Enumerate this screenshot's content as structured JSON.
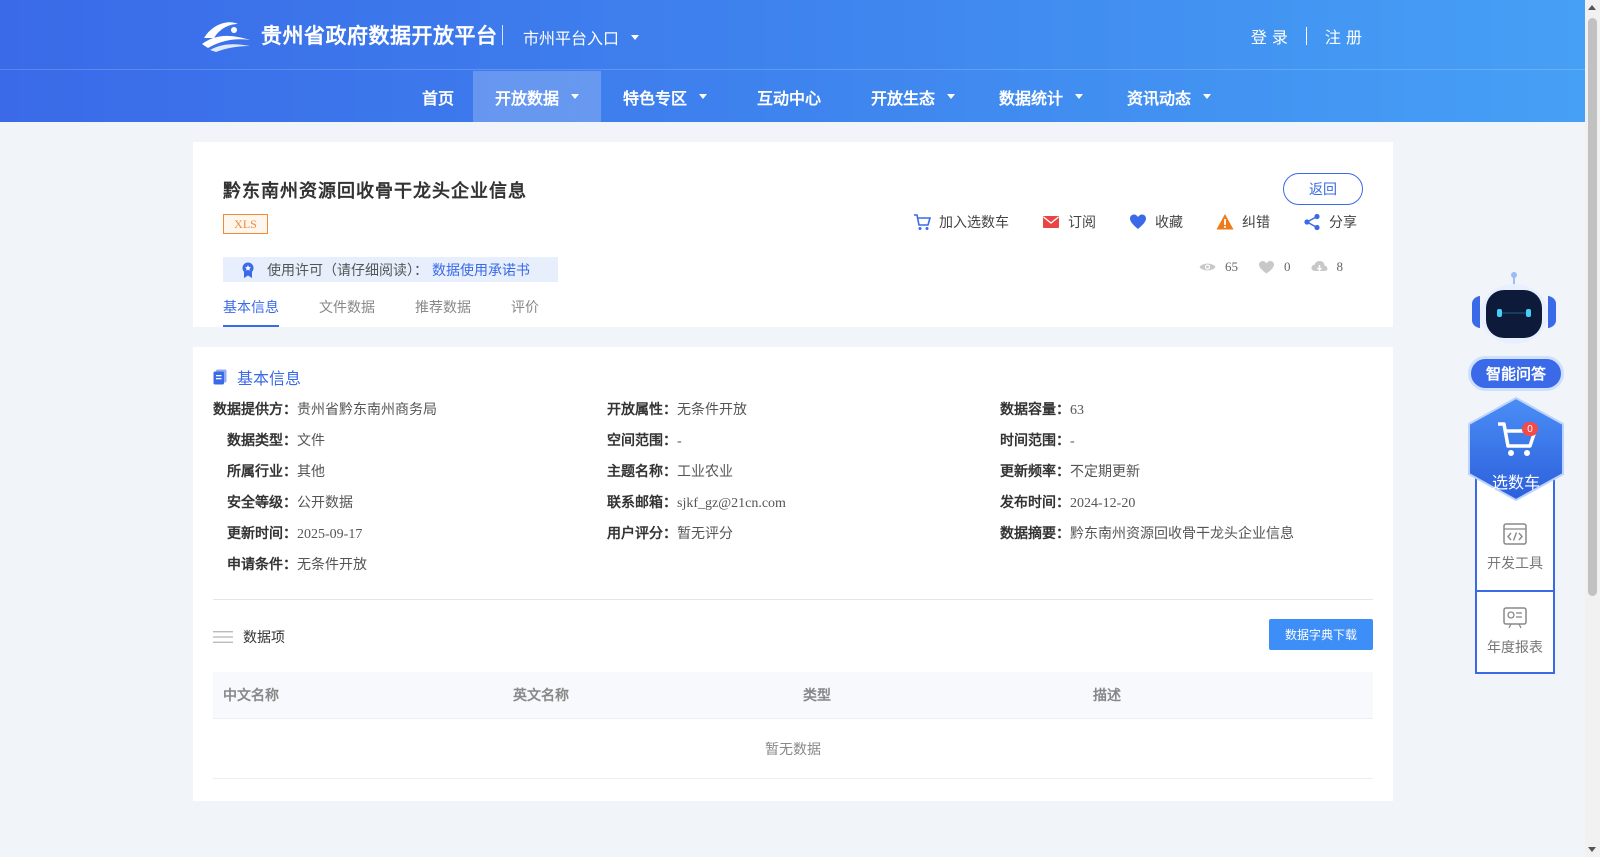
{
  "header": {
    "site_title": "贵州省政府数据开放平台",
    "city_entry": "市州平台入口",
    "login": "登 录",
    "register": "注 册",
    "nav": [
      {
        "label": "首页",
        "dropdown": false
      },
      {
        "label": "开放数据",
        "dropdown": true,
        "active": true
      },
      {
        "label": "特色专区",
        "dropdown": true
      },
      {
        "label": "互动中心",
        "dropdown": false
      },
      {
        "label": "开放生态",
        "dropdown": true
      },
      {
        "label": "数据统计",
        "dropdown": true
      },
      {
        "label": "资讯动态",
        "dropdown": true
      }
    ]
  },
  "dataset": {
    "title": "黔东南州资源回收骨干龙头企业信息",
    "format": "XLS",
    "license_label": "使用许可（请仔细阅读）：",
    "license_link": "数据使用承诺书",
    "back": "返回",
    "actions": {
      "add_cart": "加入选数车",
      "subscribe": "订阅",
      "favorite": "收藏",
      "report": "纠错",
      "share": "分享"
    },
    "stats": {
      "views": "65",
      "likes": "0",
      "downloads": "8"
    },
    "tabs": [
      "基本信息",
      "文件数据",
      "推荐数据",
      "评价"
    ]
  },
  "basic_info": {
    "section_title": "基本信息",
    "rows": [
      [
        {
          "k": "数据提供方：",
          "v": "贵州省黔东南州商务局"
        },
        {
          "k": "开放属性：",
          "v": "无条件开放"
        },
        {
          "k": "数据容量：",
          "v": "63"
        }
      ],
      [
        {
          "k": "数据类型：",
          "v": "文件"
        },
        {
          "k": "空间范围：",
          "v": "-"
        },
        {
          "k": "时间范围：",
          "v": "-"
        }
      ],
      [
        {
          "k": "所属行业：",
          "v": "其他"
        },
        {
          "k": "主题名称：",
          "v": "工业农业"
        },
        {
          "k": "更新频率：",
          "v": "不定期更新"
        }
      ],
      [
        {
          "k": "安全等级：",
          "v": "公开数据"
        },
        {
          "k": "联系邮箱：",
          "v": "sjkf_gz@21cn.com"
        },
        {
          "k": "发布时间：",
          "v": "2024-12-20"
        }
      ],
      [
        {
          "k": "更新时间：",
          "v": "2025-09-17"
        },
        {
          "k": "用户评分：",
          "v": "暂无评分"
        },
        {
          "k": "数据摘要：",
          "v": "黔东南州资源回收骨干龙头企业信息"
        }
      ],
      [
        {
          "k": "申请条件：",
          "v": "无条件开放"
        }
      ]
    ]
  },
  "data_items": {
    "title": "数据项",
    "download_btn": "数据字典下载",
    "columns": [
      "中文名称",
      "英文名称",
      "类型",
      "描述"
    ],
    "empty_text": "暂无数据"
  },
  "widget": {
    "ask": "智能问答",
    "cart": "选数车",
    "cart_count": "0",
    "dev_tools": "开发工具",
    "annual_report": "年度报表"
  },
  "colors": {
    "primary": "#3a6ae8",
    "accent_orange": "#f08a3b",
    "button_blue": "#3d8ef7"
  }
}
